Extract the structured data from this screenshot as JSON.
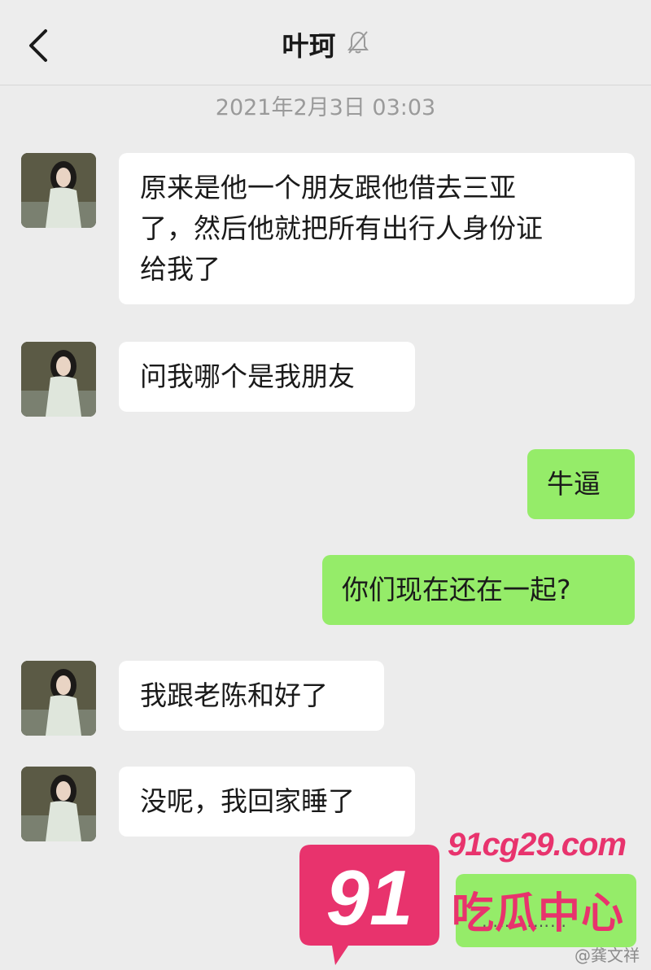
{
  "header": {
    "title": "叶珂",
    "back_icon": "chevron-left-icon",
    "mute_icon": "bell-off-icon"
  },
  "timestamp": "2021年2月3日 03:03",
  "messages": [
    {
      "side": "left",
      "lines": [
        "原来是他一个朋友跟他借去三亚",
        "了，然后他就把所有出行人身份证",
        "给我了"
      ]
    },
    {
      "side": "left",
      "lines": [
        "问我哪个是我朋友"
      ]
    },
    {
      "side": "right",
      "lines": [
        "牛逼"
      ]
    },
    {
      "side": "right",
      "lines": [
        "你们现在还在一起?"
      ]
    },
    {
      "side": "left",
      "lines": [
        "我跟老陈和好了"
      ]
    },
    {
      "side": "left",
      "lines": [
        "没呢，我回家睡了"
      ]
    }
  ],
  "watermark": {
    "number": "91",
    "url": "91cg29.com",
    "name": "吃瓜中心",
    "dots": "……………",
    "credit": "@龚文祥"
  },
  "colors": {
    "bg": "#ececec",
    "left_bubble": "#ffffff",
    "right_bubble": "#95ec69",
    "watermark": "#e8336d"
  }
}
